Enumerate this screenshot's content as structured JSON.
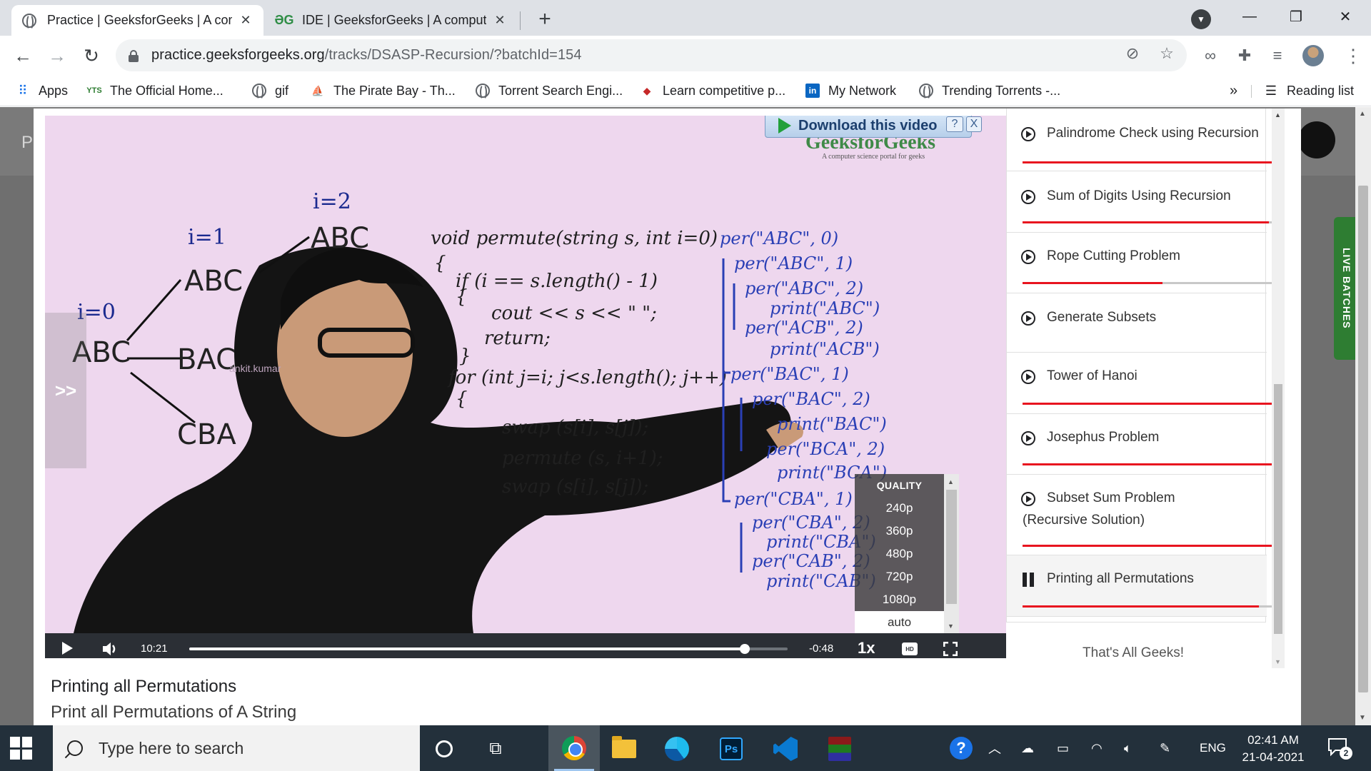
{
  "browser": {
    "tabs": [
      {
        "title": "Practice | GeeksforGeeks | A com",
        "active": true
      },
      {
        "title": "IDE | GeeksforGeeks | A compute",
        "active": false
      }
    ],
    "url_host": "practice.geeksforgeeks.org",
    "url_path": "/tracks/DSASP-Recursion/?batchId=154",
    "bookmarks": [
      {
        "label": "Apps",
        "icon": "apps-grid-icon"
      },
      {
        "label": "The Official Home...",
        "icon": "site-icon"
      },
      {
        "label": "gif",
        "icon": "globe-icon"
      },
      {
        "label": "The Pirate Bay - Th...",
        "icon": "ship-icon"
      },
      {
        "label": "Torrent Search Engi...",
        "icon": "globe-icon"
      },
      {
        "label": "Learn competitive p...",
        "icon": "cube-icon"
      },
      {
        "label": "My Network",
        "icon": "linkedin-icon"
      },
      {
        "label": "Trending Torrents -...",
        "icon": "globe-icon"
      }
    ],
    "more_bookmarks": "»",
    "reading_list": "Reading list"
  },
  "page_bg": {
    "letter": "Pr",
    "live_badge": "LIVE BATCHES"
  },
  "video": {
    "logo": "GeeksforGeeks",
    "logo_tagline": "A computer science portal for geeks",
    "download_label": "Download this video",
    "help": "?",
    "close": "X",
    "side_arrows": ">>",
    "watermark": "ankit.kumar",
    "quality": {
      "title": "QUALITY",
      "options": [
        "240p",
        "360p",
        "480p",
        "720p",
        "1080p",
        "auto"
      ],
      "selected": "auto"
    },
    "controls": {
      "elapsed": "10:21",
      "remaining": "-0:48",
      "progress": 0.928,
      "speed": "1x",
      "hd": "HD"
    },
    "board": {
      "i0": "i=0",
      "i1": "i=1",
      "i2": "i=2",
      "root": "ABC",
      "l1_a": "ABC",
      "l1_b": "BAC",
      "l1_c": "CBA",
      "l2_a": "ABC",
      "code": [
        "void permute(string s,  int i=0)",
        "{",
        "if (i == s.length() - 1)",
        "{",
        "cout << s << \" \";",
        "return;",
        "}",
        "for (int j=i; j<s.length(); j++)",
        "{",
        "swap (s[i], s[j]);",
        "permute (s, i+1);",
        "swap (s[i], s[j]);"
      ],
      "trace": [
        "per(\"ABC\", 0)",
        "per(\"ABC\", 1)",
        "per(\"ABC\", 2)",
        "print(\"ABC\")",
        "per(\"ACB\", 2)",
        "print(\"ACB\")",
        "per(\"BAC\", 1)",
        "per(\"BAC\", 2)",
        "print(\"BAC\")",
        "per(\"BCA\", 2)",
        "print(\"BCA\")",
        "per(\"CBA\", 1)",
        "per(\"CBA\", 2)",
        "print(\"CBA\")",
        "per(\"CAB\", 2)",
        "print(\"CAB\")"
      ]
    }
  },
  "lesson": {
    "title": "Printing all Permutations",
    "subtitle": "Print all Permutations of A String"
  },
  "playlist": {
    "items": [
      {
        "label": "Palindrome Check using Recursion",
        "progress": 0.995
      },
      {
        "label": "Sum of Digits Using Recursion",
        "progress": 0.97
      },
      {
        "label": "Rope Cutting Problem",
        "progress": 0.55
      },
      {
        "label": "Generate Subsets",
        "progress": 0.0
      },
      {
        "label": "Tower of Hanoi",
        "progress": 0.995
      },
      {
        "label": "Josephus Problem",
        "progress": 0.995
      },
      {
        "label": "Subset Sum Problem (Recursive Solution)",
        "progress": 0.995
      },
      {
        "label": "Printing all Permutations",
        "progress": 0.93,
        "active": true
      }
    ],
    "footer": "That's All Geeks!"
  },
  "taskbar": {
    "search_placeholder": "Type here to search",
    "language": "ENG",
    "time": "02:41 AM",
    "date": "21-04-2021",
    "notifications": "2"
  },
  "colors": {
    "accent_red": "#e8141f",
    "board_ink": "#2a3fb5",
    "board_bg": "#eed7ee",
    "taskbar": "#23303b"
  }
}
